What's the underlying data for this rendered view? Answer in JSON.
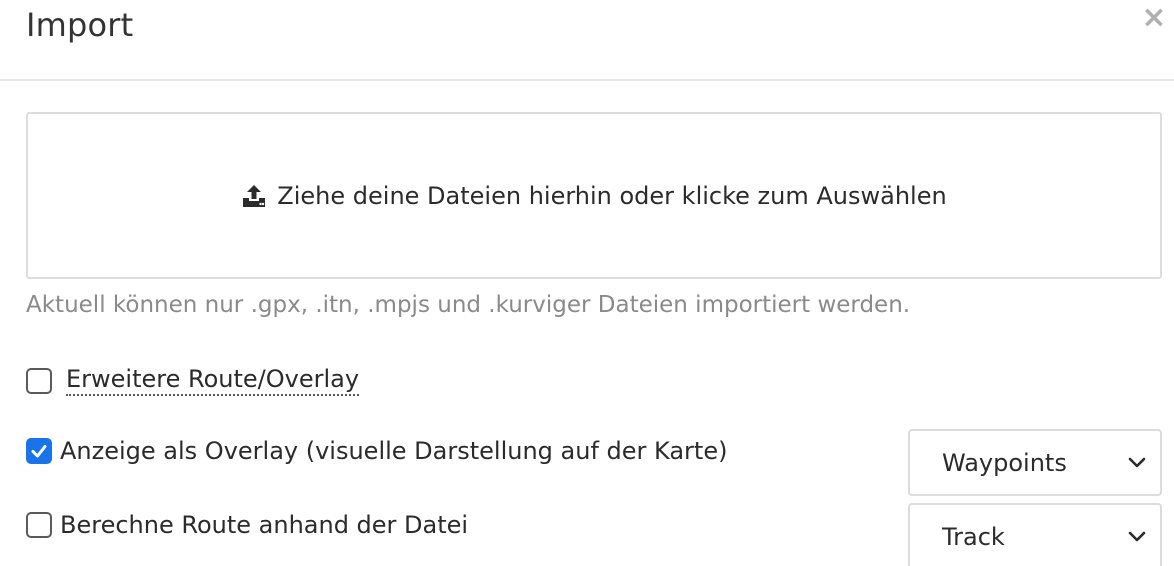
{
  "dialog": {
    "title": "Import",
    "close_glyph": "×"
  },
  "dropzone": {
    "icon": "upload-icon",
    "label": "Ziehe deine Dateien hierhin oder klicke zum Auswählen"
  },
  "hint": "Aktuell können nur .gpx, .itn, .mpjs und .kurviger Dateien importiert werden.",
  "options": [
    {
      "label": "Erweitere Route/Overlay",
      "checked": false
    },
    {
      "label": "Anzeige als Overlay (visuelle Darstellung auf der Karte)",
      "checked": true
    },
    {
      "label": "Berechne Route anhand der Datei",
      "checked": false
    }
  ],
  "selects": {
    "overlay_type": "Waypoints",
    "route_type": "Track"
  },
  "colors": {
    "accent": "#1a73e8",
    "hint_text": "#8a8a8a",
    "border": "#dddddd"
  }
}
